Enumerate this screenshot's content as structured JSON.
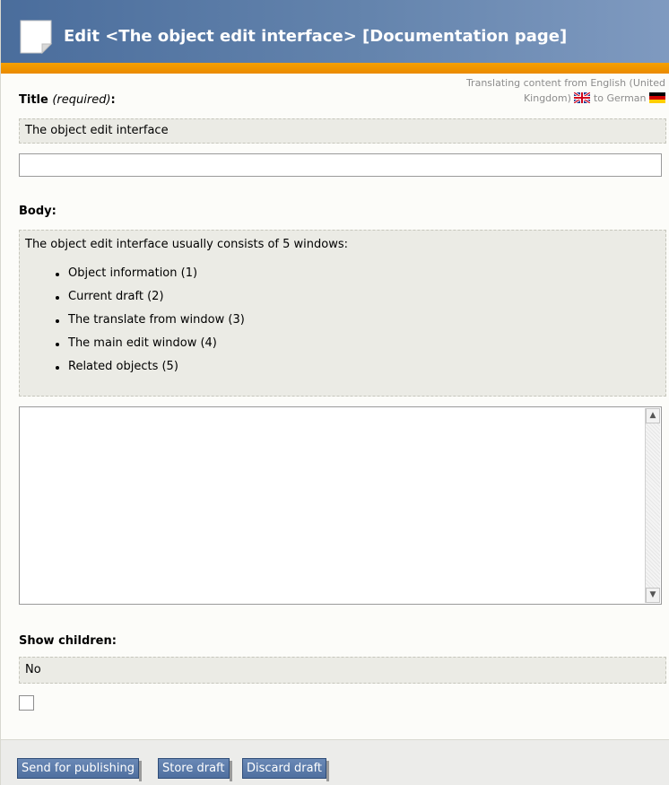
{
  "header": {
    "title": "Edit <The object edit interface> [Documentation page]"
  },
  "translation": {
    "line1": "Translating content from English (United",
    "line2": "Kingdom)",
    "to_text": "to German",
    "from_flag": "uk-flag-icon",
    "to_flag": "german-flag-icon"
  },
  "title_field": {
    "label": "Title",
    "required_note": "(required)",
    "colon": ":",
    "reference_value": "The object edit interface",
    "value": ""
  },
  "body_field": {
    "label": "Body:",
    "reference_intro": "The object edit interface usually consists of 5 windows:",
    "reference_items": [
      "Object information (1)",
      "Current draft (2)",
      "The translate from window (3)",
      "The main edit window (4)",
      "Related objects (5)"
    ],
    "value": ""
  },
  "show_children": {
    "label": "Show children:",
    "reference_value": "No",
    "checked": false
  },
  "buttons": {
    "send": "Send for publishing",
    "store": "Store draft",
    "discard": "Discard draft"
  },
  "colors": {
    "header_bg": "#5577a6",
    "accent_stripe": "#f39c00",
    "button_bg": "#5b7bab",
    "reference_bg": "#ebebe5"
  }
}
